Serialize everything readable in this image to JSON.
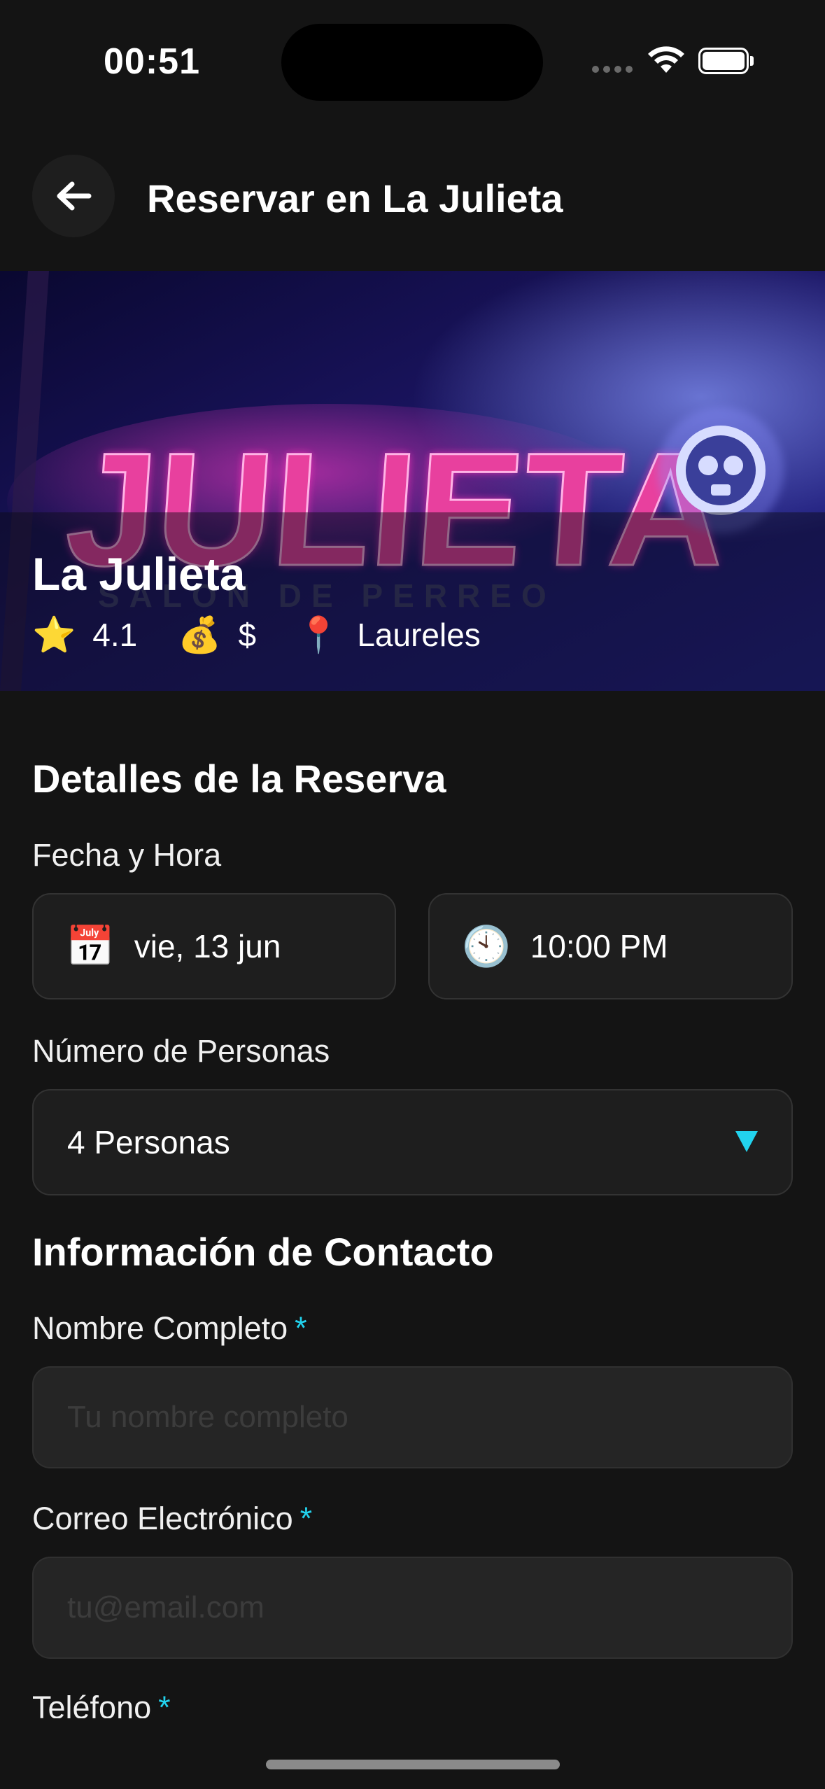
{
  "status_bar": {
    "time": "00:51"
  },
  "header": {
    "title": "Reservar en La Julieta",
    "back_icon": "arrow-left-icon"
  },
  "venue": {
    "name": "La Julieta",
    "rating": "4.1",
    "price": "$",
    "location": "Laureles",
    "rating_icon": "⭐",
    "price_icon": "💰",
    "location_icon": "📍",
    "hero_sign_text": "JULIETA",
    "hero_subtext": "SALON DE PERREO"
  },
  "booking": {
    "section_title": "Detalles de la Reserva",
    "datetime_label": "Fecha y Hora",
    "date_icon": "📅",
    "date_value": "vie, 13 jun",
    "time_icon": "🕙",
    "time_value": "10:00 PM",
    "people_label": "Número de Personas",
    "people_value": "4 Personas"
  },
  "contact": {
    "section_title": "Información de Contacto",
    "required_mark": "*",
    "name_label": "Nombre Completo",
    "name_placeholder": "Tu nombre completo",
    "email_label": "Correo Electrónico",
    "email_placeholder": "tu@email.com",
    "phone_label": "Teléfono"
  },
  "colors": {
    "accent": "#22d3ee",
    "background": "#141414",
    "field": "#1e1e1e"
  }
}
